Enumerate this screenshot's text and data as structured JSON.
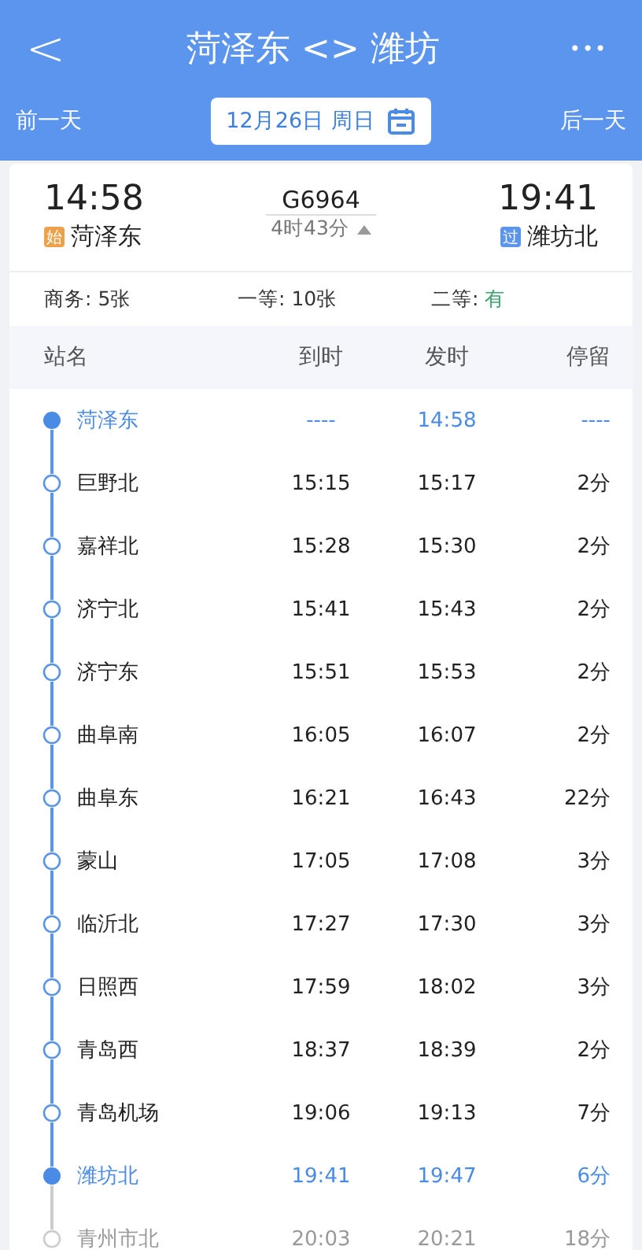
{
  "header": {
    "back": "<",
    "title": "菏泽东 <> 潍坊",
    "more": "•••",
    "prev_day": "前一天",
    "date": "12月26日 周日",
    "next_day": "后一天"
  },
  "train": {
    "depart_time": "14:58",
    "depart_badge": "始",
    "depart_station": "菏泽东",
    "number": "G6964",
    "duration": "4时43分",
    "expanded": true,
    "arrive_time": "19:41",
    "arrive_badge": "过",
    "arrive_station": "潍坊北"
  },
  "seats": [
    {
      "label": "商务: ",
      "value": "5张",
      "available": false
    },
    {
      "label": "一等: ",
      "value": "10张",
      "available": false
    },
    {
      "label": "二等: ",
      "value": "有",
      "available": true
    }
  ],
  "table": {
    "columns": [
      "站名",
      "到时",
      "发时",
      "停留"
    ],
    "rows": [
      {
        "kind": "endpoint",
        "station": "菏泽东",
        "arrive": "----",
        "depart": "14:58",
        "stay": "----"
      },
      {
        "kind": "stop",
        "station": "巨野北",
        "arrive": "15:15",
        "depart": "15:17",
        "stay": "2分"
      },
      {
        "kind": "stop",
        "station": "嘉祥北",
        "arrive": "15:28",
        "depart": "15:30",
        "stay": "2分"
      },
      {
        "kind": "stop",
        "station": "济宁北",
        "arrive": "15:41",
        "depart": "15:43",
        "stay": "2分"
      },
      {
        "kind": "stop",
        "station": "济宁东",
        "arrive": "15:51",
        "depart": "15:53",
        "stay": "2分"
      },
      {
        "kind": "stop",
        "station": "曲阜南",
        "arrive": "16:05",
        "depart": "16:07",
        "stay": "2分"
      },
      {
        "kind": "stop",
        "station": "曲阜东",
        "arrive": "16:21",
        "depart": "16:43",
        "stay": "22分"
      },
      {
        "kind": "stop",
        "station": "蒙山",
        "arrive": "17:05",
        "depart": "17:08",
        "stay": "3分"
      },
      {
        "kind": "stop",
        "station": "临沂北",
        "arrive": "17:27",
        "depart": "17:30",
        "stay": "3分"
      },
      {
        "kind": "stop",
        "station": "日照西",
        "arrive": "17:59",
        "depart": "18:02",
        "stay": "3分"
      },
      {
        "kind": "stop",
        "station": "青岛西",
        "arrive": "18:37",
        "depart": "18:39",
        "stay": "2分"
      },
      {
        "kind": "stop",
        "station": "青岛机场",
        "arrive": "19:06",
        "depart": "19:13",
        "stay": "7分"
      },
      {
        "kind": "endpoint",
        "station": "潍坊北",
        "arrive": "19:41",
        "depart": "19:47",
        "stay": "6分"
      },
      {
        "kind": "beyond",
        "station": "青州市北",
        "arrive": "20:03",
        "depart": "20:21",
        "stay": "18分"
      }
    ]
  }
}
